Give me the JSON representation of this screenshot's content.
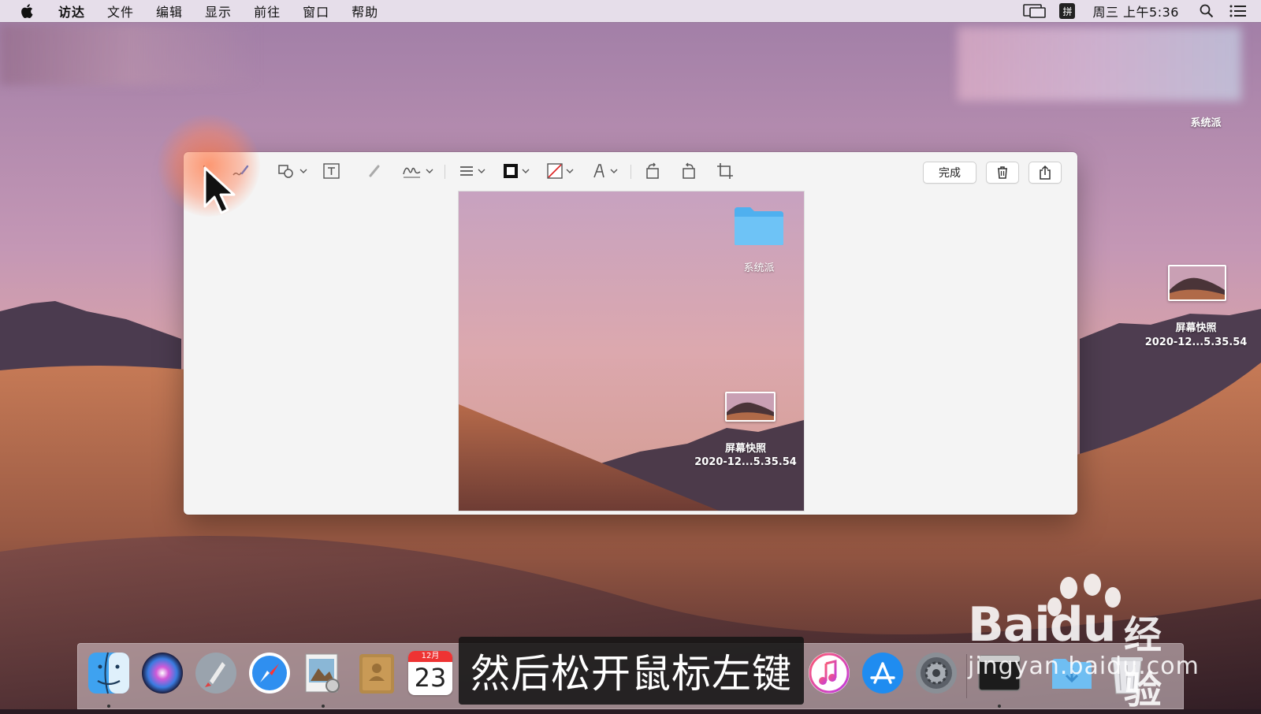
{
  "menubar": {
    "app_name": "访达",
    "items": [
      "文件",
      "编辑",
      "显示",
      "前往",
      "窗口",
      "帮助"
    ],
    "ime_label": "拼",
    "clock": "周三 上午5:36"
  },
  "desktop": {
    "folder_label": "系统派",
    "file_label_line1": "屏幕快照",
    "file_label_line2": "2020-12...5.35.54"
  },
  "window": {
    "done_label": "完成",
    "canvas": {
      "folder_label": "系统派",
      "file_label_line1": "屏幕快照",
      "file_label_line2": "2020-12...5.35.54"
    }
  },
  "dock": {
    "calendar_month": "12月",
    "calendar_day": "23",
    "apps": [
      "Finder",
      "Siri",
      "Launchpad",
      "Safari",
      "Preview",
      "Notes",
      "Calendar",
      "iTunes",
      "App Store",
      "System Preferences",
      "Terminal",
      "Downloads",
      "Trash"
    ]
  },
  "subtitle": "然后松开鼠标左键",
  "watermark": {
    "brand": "Bai",
    "brand_suffix": "du",
    "cn": "经验",
    "url": "jingyan.baidu.com"
  },
  "colors": {
    "sky_top": "#b88fb3",
    "sky_bottom": "#e8b0a4",
    "dune": "#b86b4a",
    "mountain": "#4a3a4c",
    "click_highlight": "#ff7a4a",
    "folder_blue": "#5ab8f2"
  }
}
